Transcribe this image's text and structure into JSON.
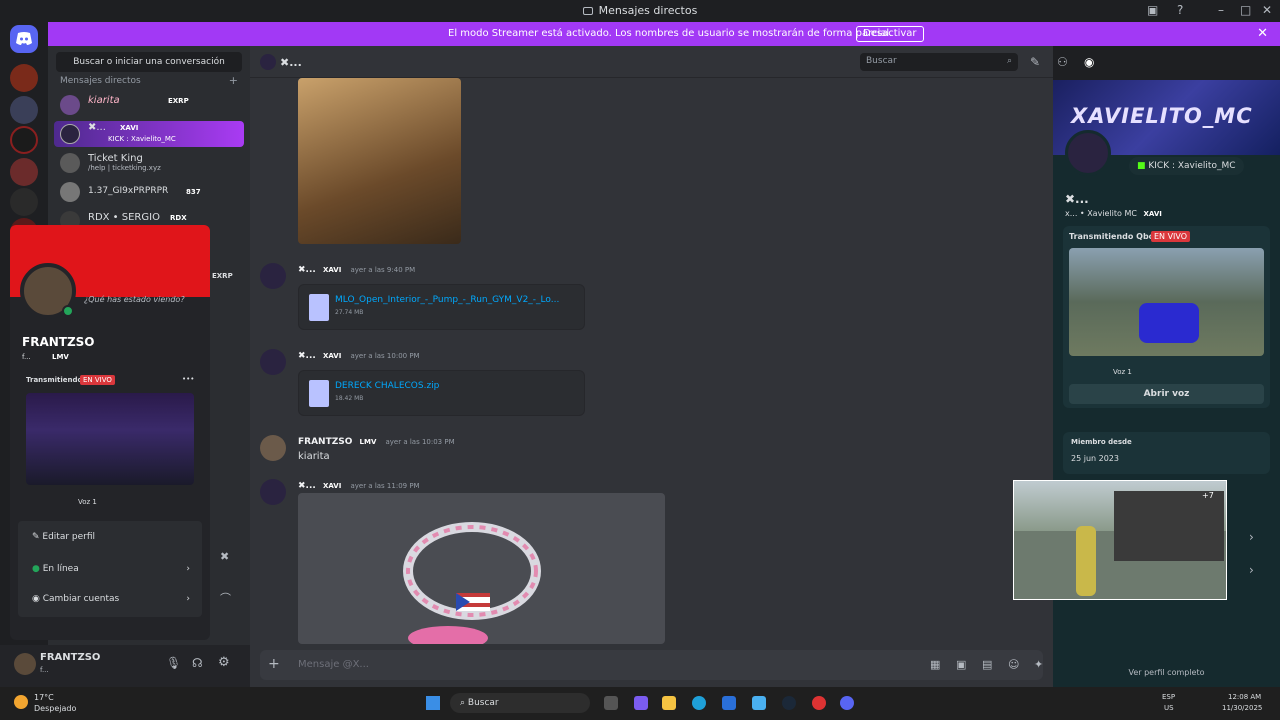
{
  "window": {
    "title": "Mensajes directos",
    "minimize": "–",
    "maximize": "□",
    "close": "✕"
  },
  "streamer_banner": {
    "message": "El modo Streamer está activado. Los nombres de usuario se mostrarán de forma parcial.",
    "button": "Desactivar",
    "close": "✕"
  },
  "dm_sidebar": {
    "search_label": "Buscar o iniciar una conversación",
    "section_title": "Mensajes directos",
    "add": "+",
    "items": [
      {
        "name": "kiarita",
        "tag": "EXRP",
        "sub": ""
      },
      {
        "name": "✖...",
        "tag": "XAVI",
        "sub": "KICK : Xavielito_MC"
      },
      {
        "name": "Ticket King",
        "tag": "",
        "sub": "/help | ticketking.xyz"
      },
      {
        "name": "1.37_GI9xPRPRPR",
        "tag": "837",
        "sub": ""
      },
      {
        "name": "RDX • SERGIO",
        "tag": "RDX",
        "sub": ""
      }
    ],
    "hidden_tag": "EXRP"
  },
  "popout": {
    "status_placeholder": "¿Qué has estado viendo?",
    "display_name": "FRANTZSO",
    "username": "f...",
    "tag": "LMV",
    "streaming_label": "Transmitiendo",
    "live_badge": "EN VIVO",
    "more": "•••",
    "voice_label": "Voz 1",
    "edit_profile": "Editar perfil",
    "status": "En línea",
    "switch_accounts": "Cambiar cuentas"
  },
  "user_bar": {
    "name": "FRANTZSO",
    "sub": "f..."
  },
  "chat": {
    "header_name": "✖...",
    "search_placeholder": "Buscar",
    "messages": [
      {
        "author": "✖...",
        "tag": "XAVI",
        "time": "ayer a las 9:40 PM",
        "file": "MLO_Open_Interior_-_Pump_-_Run_GYM_V2_-_Lo...",
        "size": "27.74 MB"
      },
      {
        "author": "✖...",
        "tag": "XAVI",
        "time": "ayer a las 10:00 PM",
        "file": "DERECK CHALECOS.zip",
        "size": "18.42 MB"
      },
      {
        "author": "FRANTZSO",
        "tag": "LMV",
        "time": "ayer a las 10:03 PM",
        "text": "kiarita"
      },
      {
        "author": "✖...",
        "tag": "XAVI",
        "time": "ayer a las 11:09 PM"
      }
    ],
    "input_placeholder": "Mensaje @X..."
  },
  "profile_panel": {
    "banner_name": "XAVIELITO_MC",
    "connection": "KICK : Xavielito_MC",
    "display_name": "✖...",
    "username": "x...",
    "username_full": "Xavielito MC",
    "tag": "XAVI",
    "streaming_label": "Transmitiendo Qbox",
    "live_badge": "EN VIVO",
    "voice_label": "Voz 1",
    "join_voice": "Abrir voz",
    "member_since_label": "Miembro desde",
    "member_since": "25 jun 2023",
    "view_full": "Ver perfil completo"
  },
  "overlay": {
    "count": "+7"
  },
  "taskbar": {
    "weather_temp": "17°C",
    "weather_desc": "Despejado",
    "search": "Buscar",
    "lang": "ESP",
    "region": "US",
    "time": "12:08 AM",
    "date": "11/30/2025"
  },
  "colors": {
    "accent": "#a239f5",
    "live": "#da373c",
    "link": "#00a8fc",
    "online": "#23a55a"
  }
}
